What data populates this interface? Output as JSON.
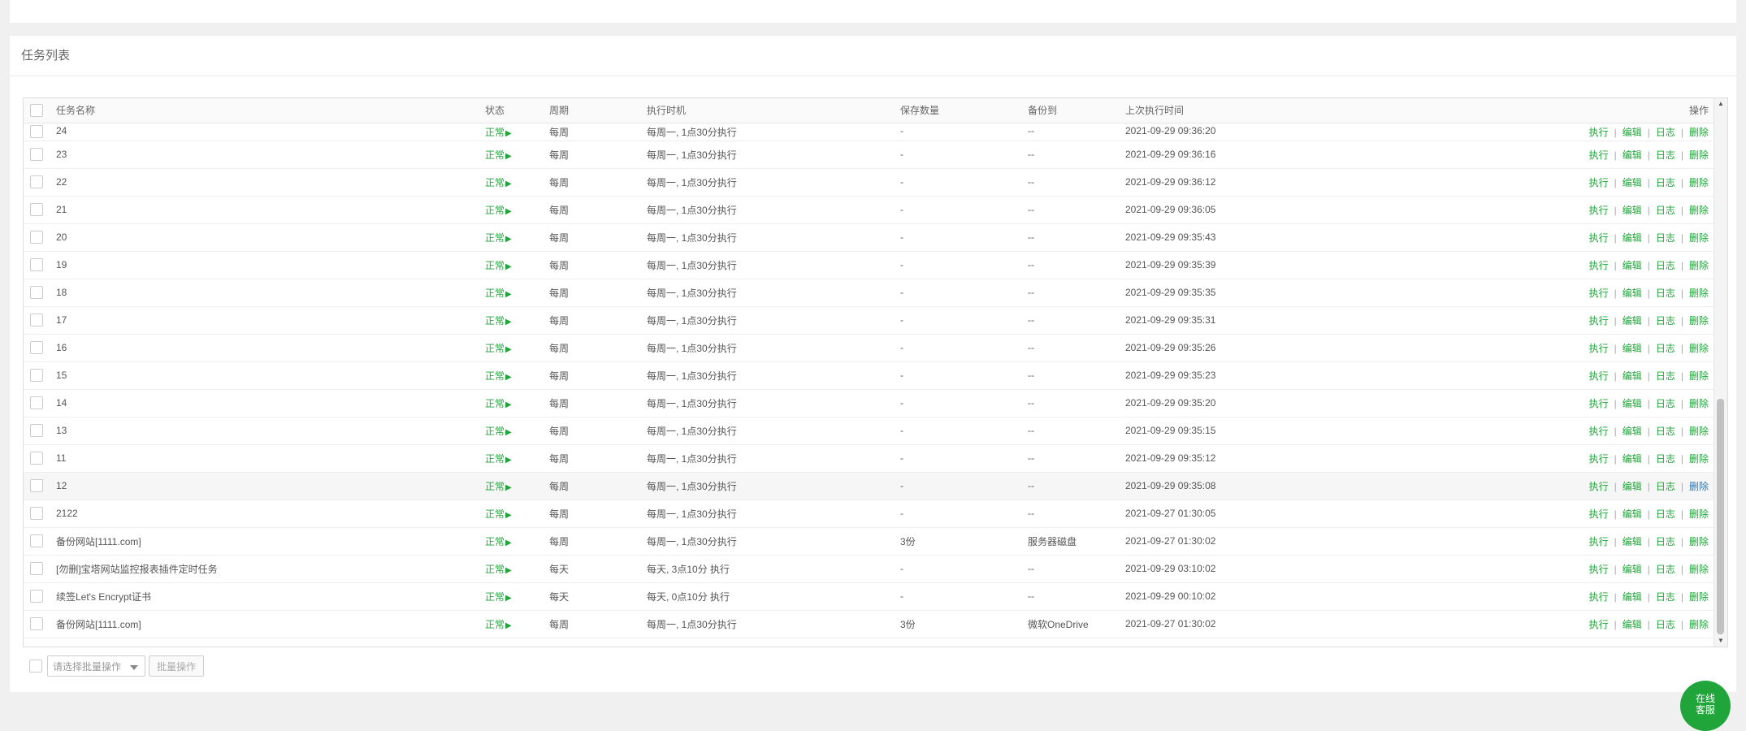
{
  "panel": {
    "title": "任务列表"
  },
  "table": {
    "columns": [
      "任务名称",
      "状态",
      "周期",
      "执行时机",
      "保存数量",
      "备份到",
      "上次执行时间",
      "操作"
    ],
    "actions": [
      "执行",
      "编辑",
      "日志",
      "删除"
    ],
    "rows": [
      {
        "name": "24",
        "status": "正常",
        "cycle": "每周",
        "when": "每周一, 1点30分执行",
        "count": "-",
        "backup": "--",
        "last": "2021-09-29 09:36:20"
      },
      {
        "name": "23",
        "status": "正常",
        "cycle": "每周",
        "when": "每周一, 1点30分执行",
        "count": "-",
        "backup": "--",
        "last": "2021-09-29 09:36:16"
      },
      {
        "name": "22",
        "status": "正常",
        "cycle": "每周",
        "when": "每周一, 1点30分执行",
        "count": "-",
        "backup": "--",
        "last": "2021-09-29 09:36:12"
      },
      {
        "name": "21",
        "status": "正常",
        "cycle": "每周",
        "when": "每周一, 1点30分执行",
        "count": "-",
        "backup": "--",
        "last": "2021-09-29 09:36:05"
      },
      {
        "name": "20",
        "status": "正常",
        "cycle": "每周",
        "when": "每周一, 1点30分执行",
        "count": "-",
        "backup": "--",
        "last": "2021-09-29 09:35:43"
      },
      {
        "name": "19",
        "status": "正常",
        "cycle": "每周",
        "when": "每周一, 1点30分执行",
        "count": "-",
        "backup": "--",
        "last": "2021-09-29 09:35:39"
      },
      {
        "name": "18",
        "status": "正常",
        "cycle": "每周",
        "when": "每周一, 1点30分执行",
        "count": "-",
        "backup": "--",
        "last": "2021-09-29 09:35:35"
      },
      {
        "name": "17",
        "status": "正常",
        "cycle": "每周",
        "when": "每周一, 1点30分执行",
        "count": "-",
        "backup": "--",
        "last": "2021-09-29 09:35:31"
      },
      {
        "name": "16",
        "status": "正常",
        "cycle": "每周",
        "when": "每周一, 1点30分执行",
        "count": "-",
        "backup": "--",
        "last": "2021-09-29 09:35:26"
      },
      {
        "name": "15",
        "status": "正常",
        "cycle": "每周",
        "when": "每周一, 1点30分执行",
        "count": "-",
        "backup": "--",
        "last": "2021-09-29 09:35:23"
      },
      {
        "name": "14",
        "status": "正常",
        "cycle": "每周",
        "when": "每周一, 1点30分执行",
        "count": "-",
        "backup": "--",
        "last": "2021-09-29 09:35:20"
      },
      {
        "name": "13",
        "status": "正常",
        "cycle": "每周",
        "when": "每周一, 1点30分执行",
        "count": "-",
        "backup": "--",
        "last": "2021-09-29 09:35:15"
      },
      {
        "name": "11",
        "status": "正常",
        "cycle": "每周",
        "when": "每周一, 1点30分执行",
        "count": "-",
        "backup": "--",
        "last": "2021-09-29 09:35:12"
      },
      {
        "name": "12",
        "status": "正常",
        "cycle": "每周",
        "when": "每周一, 1点30分执行",
        "count": "-",
        "backup": "--",
        "last": "2021-09-29 09:35:08"
      },
      {
        "name": "2122",
        "status": "正常",
        "cycle": "每周",
        "when": "每周一, 1点30分执行",
        "count": "-",
        "backup": "--",
        "last": "2021-09-27 01:30:05"
      },
      {
        "name": "备份网站[1111.com]",
        "status": "正常",
        "cycle": "每周",
        "when": "每周一, 1点30分执行",
        "count": "3份",
        "backup": "服务器磁盘",
        "last": "2021-09-27 01:30:02"
      },
      {
        "name": "[勿删]宝塔网站监控报表插件定时任务",
        "status": "正常",
        "cycle": "每天",
        "when": "每天, 3点10分 执行",
        "count": "-",
        "backup": "--",
        "last": "2021-09-29 03:10:02"
      },
      {
        "name": "续签Let's Encrypt证书",
        "status": "正常",
        "cycle": "每天",
        "when": "每天, 0点10分 执行",
        "count": "-",
        "backup": "--",
        "last": "2021-09-29 00:10:02"
      },
      {
        "name": "备份网站[1111.com]",
        "status": "正常",
        "cycle": "每周",
        "when": "每周一, 1点30分执行",
        "count": "3份",
        "backup": "微软OneDrive",
        "last": "2021-09-27 01:30:02"
      }
    ]
  },
  "footer": {
    "select_placeholder": "请选择批量操作",
    "batch_button": "批量操作"
  },
  "service_button": {
    "line1": "在线",
    "line2": "客服"
  },
  "colors": {
    "accent": "#20a53a",
    "link_blue": "#3475a9"
  }
}
